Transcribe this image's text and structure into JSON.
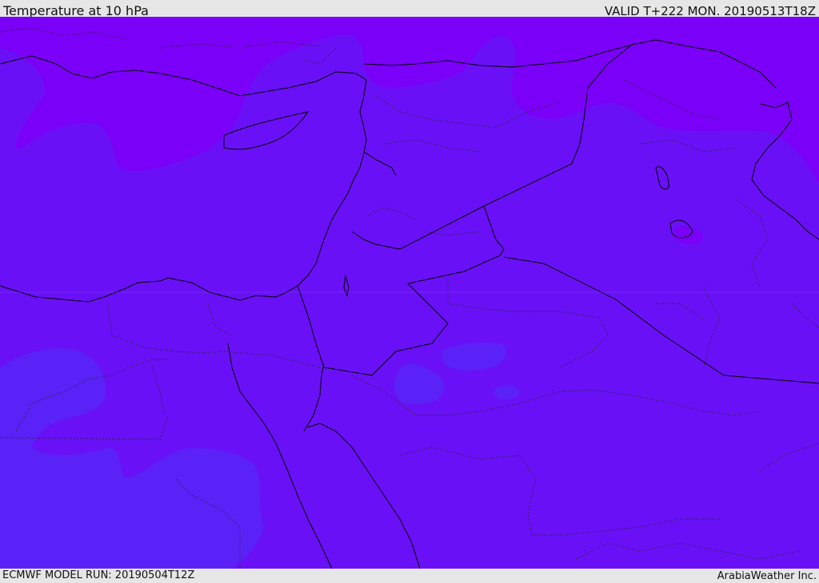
{
  "header": {
    "title": "Temperature at 10 hPa",
    "valid": "VALID T+222 MON. 20190513T18Z"
  },
  "footer": {
    "model_run": "ECMWF MODEL RUN: 20190504T12Z",
    "credit": "ArabiaWeather Inc."
  },
  "map": {
    "colors": {
      "cold_band": "#7b00f7",
      "base": "#6a10f6",
      "warm_band": "#5a22f6",
      "coast": "#000000"
    }
  }
}
